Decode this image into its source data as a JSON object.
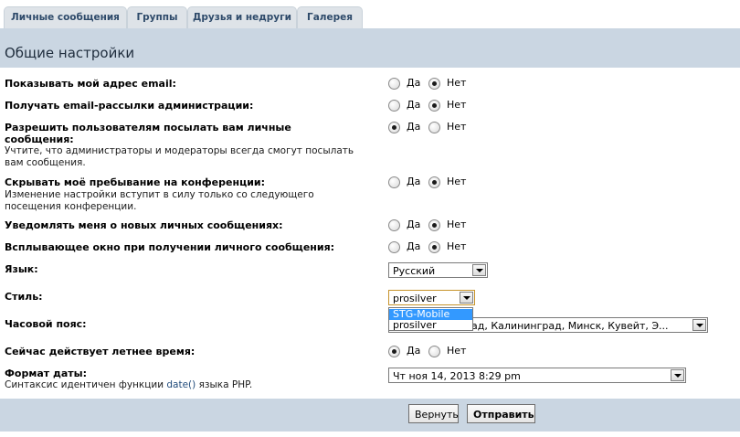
{
  "tabs": [
    {
      "label": "Личные сообщения"
    },
    {
      "label": "Группы"
    },
    {
      "label": "Друзья и недруги"
    },
    {
      "label": "Галерея"
    }
  ],
  "title": "Общие настройки",
  "yes": "Да",
  "no": "Нет",
  "rows": {
    "email": {
      "label": "Показывать мой адрес email:",
      "value": "Нет"
    },
    "admin_mail": {
      "label": "Получать email-рассылки администрации:",
      "value": "Нет"
    },
    "pm": {
      "label_1": "Разрешить пользователям посылать вам личные",
      "label_2": "сообщения:",
      "explain_1": "Учтите, что администраторы и модераторы всегда смогут посылать",
      "explain_2": "вам сообщения.",
      "value": "Да"
    },
    "hide": {
      "label": "Скрывать моё пребывание на конференции:",
      "explain_1": "Изменение настройки вступит в силу только со следующего",
      "explain_2": "посещения конференции.",
      "value": "Нет"
    },
    "notify_pm": {
      "label": "Уведомлять меня о новых личных сообщениях:",
      "value": "Нет"
    },
    "popup": {
      "label": "Всплывающее окно при получении личного сообщения:",
      "value": "Нет"
    },
    "lang": {
      "label": "Язык:",
      "value": "Русский"
    },
    "style": {
      "label": "Стиль:",
      "value": "prosilver",
      "options": [
        "STG-Mobile",
        "prosilver"
      ],
      "highlighted": "STG-Mobile"
    },
    "tz": {
      "label": "Часовой пояс:",
      "value_visible": "ад, Калининград, Минск, Кувейт, Э..."
    },
    "dst": {
      "label": "Сейчас действует летнее время:",
      "value": "Да"
    },
    "date": {
      "label": "Формат даты:",
      "explain_pre": "Синтаксис идентичен функции ",
      "explain_fn": "date()",
      "explain_post": " языка PHP.",
      "value": "Чт ноя 14, 2013 8:29 pm"
    }
  },
  "buttons": {
    "reset": "Вернуть",
    "submit": "Отправить"
  },
  "colors": {
    "panel_bg": "#cad6e2",
    "tab_bg": "#dee3e8",
    "highlight": "#3399ff"
  }
}
